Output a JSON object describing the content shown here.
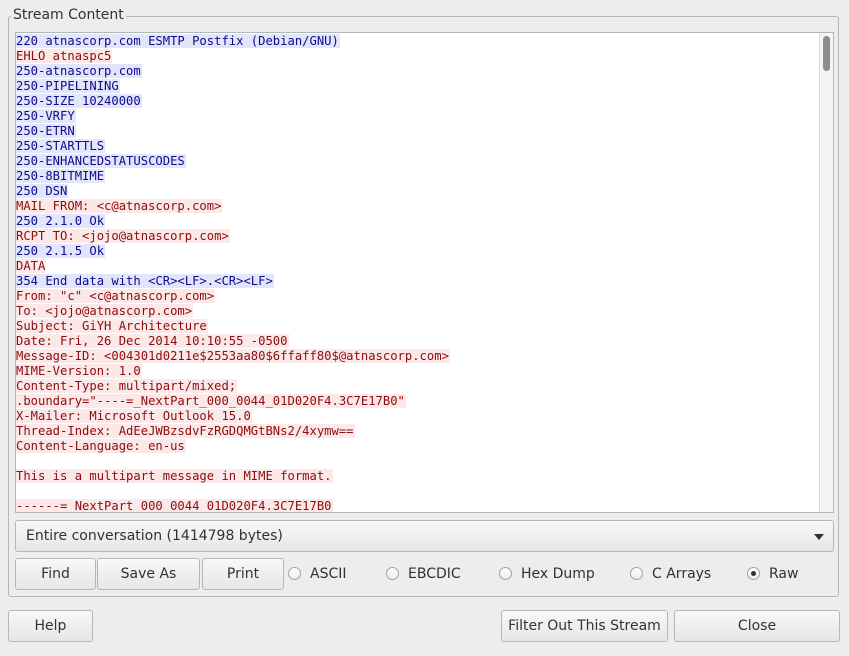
{
  "dialog": {
    "frame_label": "Stream Content"
  },
  "stream": {
    "lines": [
      {
        "dir": "server",
        "text": "220 atnascorp.com ESMTP Postfix (Debian/GNU)"
      },
      {
        "dir": "client",
        "text": "EHLO atnaspc5"
      },
      {
        "dir": "server",
        "text": "250-atnascorp.com"
      },
      {
        "dir": "server",
        "text": "250-PIPELINING"
      },
      {
        "dir": "server",
        "text": "250-SIZE 10240000"
      },
      {
        "dir": "server",
        "text": "250-VRFY"
      },
      {
        "dir": "server",
        "text": "250-ETRN"
      },
      {
        "dir": "server",
        "text": "250-STARTTLS"
      },
      {
        "dir": "server",
        "text": "250-ENHANCEDSTATUSCODES"
      },
      {
        "dir": "server",
        "text": "250-8BITMIME"
      },
      {
        "dir": "server",
        "text": "250 DSN"
      },
      {
        "dir": "client",
        "text": "MAIL FROM: <c@atnascorp.com>"
      },
      {
        "dir": "server",
        "text": "250 2.1.0 Ok"
      },
      {
        "dir": "client",
        "text": "RCPT TO: <jojo@atnascorp.com>"
      },
      {
        "dir": "server",
        "text": "250 2.1.5 Ok"
      },
      {
        "dir": "client",
        "text": "DATA"
      },
      {
        "dir": "server",
        "text": "354 End data with <CR><LF>.<CR><LF>"
      },
      {
        "dir": "client",
        "text": "From: \"c\" <c@atnascorp.com>"
      },
      {
        "dir": "client",
        "text": "To: <jojo@atnascorp.com>"
      },
      {
        "dir": "client",
        "text": "Subject: GiYH Architecture"
      },
      {
        "dir": "client",
        "text": "Date: Fri, 26 Dec 2014 10:10:55 -0500"
      },
      {
        "dir": "client",
        "text": "Message-ID: <004301d0211e$2553aa80$6ffaff80$@atnascorp.com>"
      },
      {
        "dir": "client",
        "text": "MIME-Version: 1.0"
      },
      {
        "dir": "client",
        "text": "Content-Type: multipart/mixed;"
      },
      {
        "dir": "client",
        "text": ".boundary=\"----=_NextPart_000_0044_01D020F4.3C7E17B0\""
      },
      {
        "dir": "client",
        "text": "X-Mailer: Microsoft Outlook 15.0"
      },
      {
        "dir": "client",
        "text": "Thread-Index: AdEeJWBzsdvFzRGDQMGtBNs2/4xymw=="
      },
      {
        "dir": "client",
        "text": "Content-Language: en-us"
      },
      {
        "dir": "client",
        "text": ""
      },
      {
        "dir": "client",
        "text": "This is a multipart message in MIME format."
      },
      {
        "dir": "client",
        "text": ""
      },
      {
        "dir": "client",
        "text": "------=_NextPart_000_0044_01D020F4.3C7E17B0"
      }
    ]
  },
  "conversation_select": {
    "value": "Entire conversation (1414798 bytes)"
  },
  "buttons": {
    "find": "Find",
    "save_as": "Save As",
    "print": "Print",
    "help": "Help",
    "filter_out": "Filter Out This Stream",
    "close": "Close"
  },
  "formats": [
    {
      "label": "ASCII",
      "selected": false
    },
    {
      "label": "EBCDIC",
      "selected": false
    },
    {
      "label": "Hex Dump",
      "selected": false
    },
    {
      "label": "C Arrays",
      "selected": false
    },
    {
      "label": "Raw",
      "selected": true
    }
  ],
  "colors": {
    "server_bg": "#e3e6fb",
    "server_fg": "#0b0b8d",
    "client_bg": "#fbe9e9",
    "client_fg": "#8e0c0c"
  }
}
